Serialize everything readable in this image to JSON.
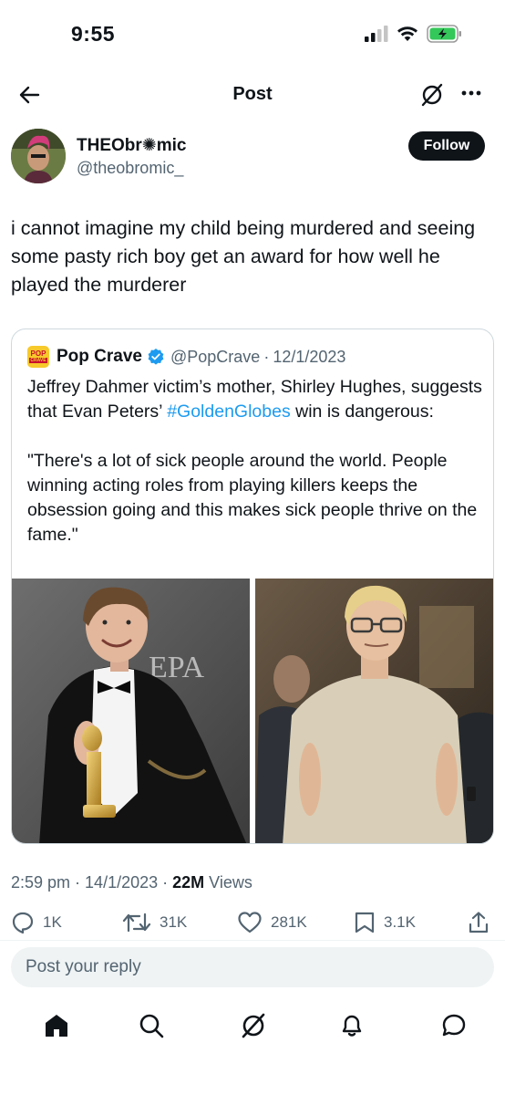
{
  "status_bar": {
    "time": "9:55"
  },
  "nav": {
    "title": "Post"
  },
  "author": {
    "name": "THEObr✺mic",
    "handle": "@theobromic_",
    "follow_label": "Follow"
  },
  "post": {
    "text": "i cannot imagine my child being murdered and seeing some pasty rich boy get an award for how well he played the murderer"
  },
  "quote": {
    "logo_text": "POP",
    "logo_subtext": "CRAVE",
    "name": "Pop Crave",
    "handle": "@PopCrave",
    "sep": "·",
    "date": "12/1/2023",
    "text_before_tag": "Jeffrey Dahmer victim’s mother, Shirley Hughes, suggests that Evan Peters’ ",
    "hashtag": "#GoldenGlobes",
    "text_after_tag": " win is dangerous:",
    "quote_paragraph": "\"There's a lot of sick people around the world. People winning acting roles from playing killers keeps the obsession going and this makes sick people thrive on the fame.\"",
    "image_left_sign": "EPA"
  },
  "meta": {
    "time": "2:59 pm",
    "sep1": " · ",
    "date": "14/1/2023",
    "sep2": " · ",
    "views_count": "22M",
    "views_label": " Views"
  },
  "actions": {
    "replies": "1K",
    "reposts": "31K",
    "likes": "281K",
    "bookmarks": "3.1K"
  },
  "reply": {
    "placeholder": "Post your reply"
  },
  "colors": {
    "accent": "#1d9bf0",
    "text": "#0f1419",
    "secondary": "#536471",
    "battery": "#34c759"
  }
}
